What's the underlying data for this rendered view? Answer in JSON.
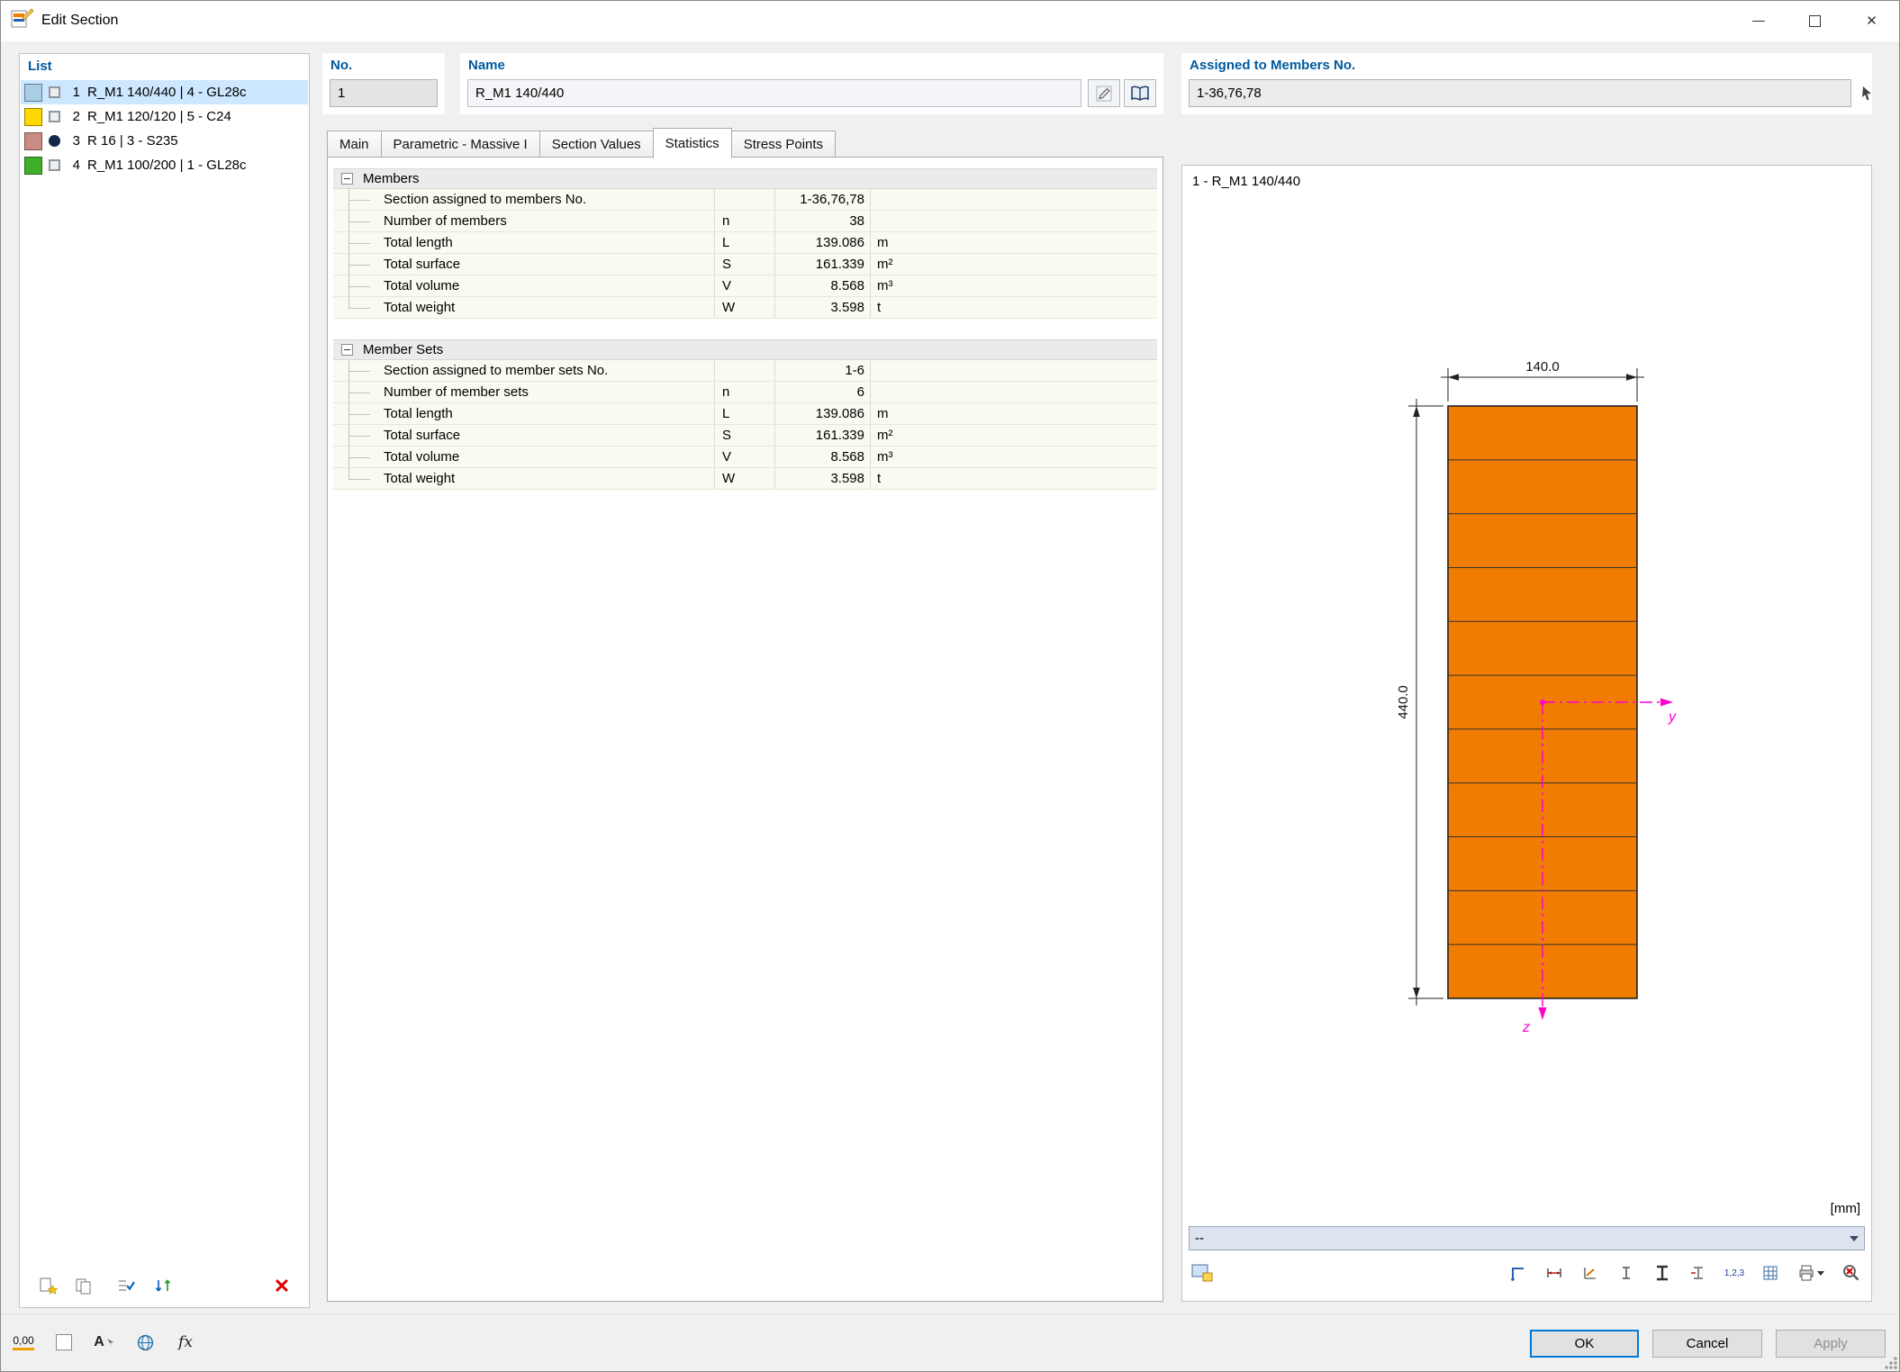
{
  "window": {
    "title": "Edit Section"
  },
  "list": {
    "label": "List",
    "items": [
      {
        "num": "1",
        "text": "R_M1 140/440 | 4 - GL28c",
        "swatch": "#a9cfe6",
        "glyph": "square",
        "selected": true
      },
      {
        "num": "2",
        "text": "R_M1 120/120 | 5 - C24",
        "swatch": "#ffd800",
        "glyph": "square",
        "selected": false
      },
      {
        "num": "3",
        "text": "R 16 | 3 - S235",
        "swatch": "#c98b84",
        "glyph": "circle",
        "selected": false
      },
      {
        "num": "4",
        "text": "R_M1 100/200 | 1 - GL28c",
        "swatch": "#3fae2a",
        "glyph": "square",
        "selected": false
      }
    ]
  },
  "fields": {
    "no": {
      "label": "No.",
      "value": "1"
    },
    "name": {
      "label": "Name",
      "value": "R_M1 140/440"
    },
    "assigned": {
      "label": "Assigned to Members No.",
      "value": "1-36,76,78"
    }
  },
  "tabs": [
    {
      "label": "Main",
      "active": false
    },
    {
      "label": "Parametric - Massive I",
      "active": false
    },
    {
      "label": "Section Values",
      "active": false
    },
    {
      "label": "Statistics",
      "active": true
    },
    {
      "label": "Stress Points",
      "active": false
    }
  ],
  "statistics": {
    "groups": [
      {
        "title": "Members",
        "rows": [
          {
            "label": "Section assigned to members No.",
            "sym": "",
            "value": "1-36,76,78",
            "unit": ""
          },
          {
            "label": "Number of members",
            "sym": "n",
            "value": "38",
            "unit": ""
          },
          {
            "label": "Total length",
            "sym": "L",
            "value": "139.086",
            "unit": "m"
          },
          {
            "label": "Total surface",
            "sym": "S",
            "value": "161.339",
            "unit": "m²"
          },
          {
            "label": "Total volume",
            "sym": "V",
            "value": "8.568",
            "unit": "m³"
          },
          {
            "label": "Total weight",
            "sym": "W",
            "value": "3.598",
            "unit": "t"
          }
        ]
      },
      {
        "title": "Member Sets",
        "rows": [
          {
            "label": "Section assigned to member sets No.",
            "sym": "",
            "value": "1-6",
            "unit": ""
          },
          {
            "label": "Number of member sets",
            "sym": "n",
            "value": "6",
            "unit": ""
          },
          {
            "label": "Total length",
            "sym": "L",
            "value": "139.086",
            "unit": "m"
          },
          {
            "label": "Total surface",
            "sym": "S",
            "value": "161.339",
            "unit": "m²"
          },
          {
            "label": "Total volume",
            "sym": "V",
            "value": "8.568",
            "unit": "m³"
          },
          {
            "label": "Total weight",
            "sym": "W",
            "value": "3.598",
            "unit": "t"
          }
        ]
      }
    ]
  },
  "preview": {
    "title": "1 - R_M1 140/440",
    "dim_width": "140.0",
    "dim_height": "440.0",
    "axis_y": "y",
    "axis_z": "z",
    "units_label": "[mm]",
    "dropdown_value": "--",
    "section_color": "#f07d02",
    "axis_color": "#ff00cc",
    "laminations": 11,
    "numbering_icon_label": "1,2,3"
  },
  "footer": {
    "ok": "OK",
    "cancel": "Cancel",
    "apply": "Apply",
    "decimal_icon_label": "0,00",
    "font_icon_label": "A",
    "fx_icon_label": "fx"
  }
}
